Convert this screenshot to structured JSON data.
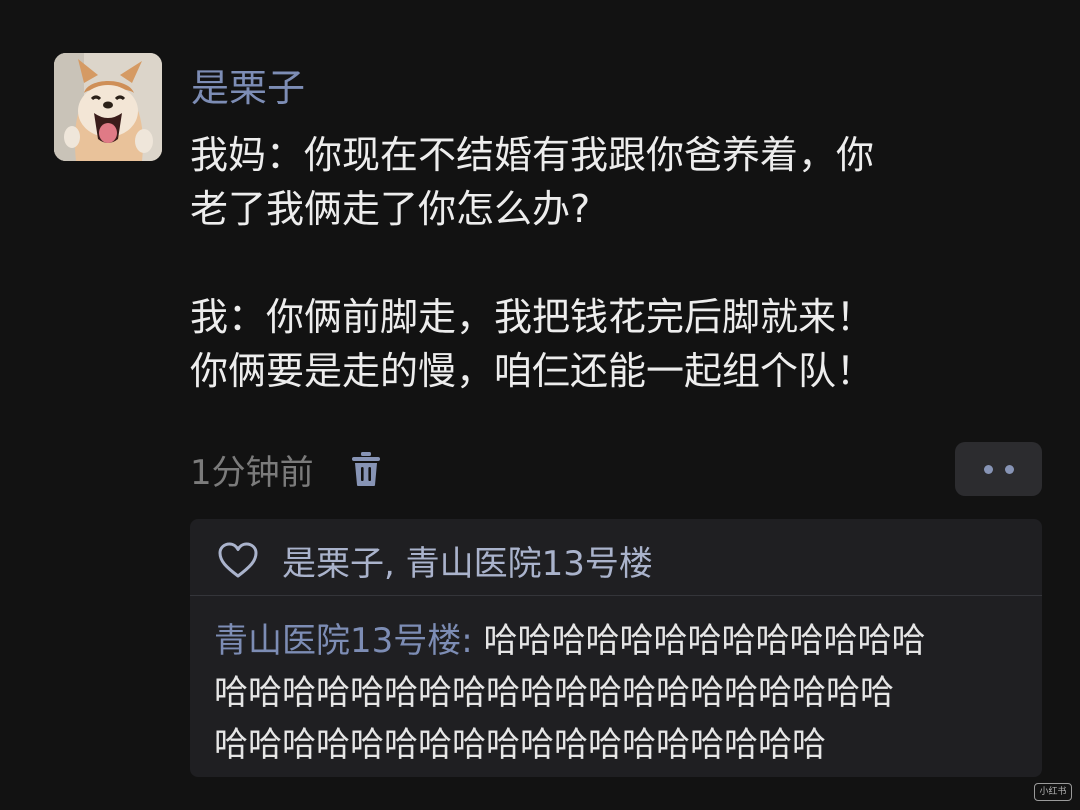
{
  "post": {
    "author": "是栗子",
    "content_lines": [
      "我妈：你现在不结婚有我跟你爸养着，你",
      "老了我俩走了你怎么办?",
      "我：你俩前脚走，我把钱花完后脚就来！",
      "你俩要是走的慢，咱仨还能一起组个队！"
    ],
    "timestamp": "1分钟前",
    "delete_icon": "trash-icon",
    "more_icon": "more-dots-icon"
  },
  "likes": {
    "icon": "heart-icon",
    "names": "是栗子, 青山医院13号楼"
  },
  "reply": {
    "author": "青山医院13号楼",
    "separator": ":",
    "text_lines": [
      "哈哈哈哈哈哈哈哈哈哈哈哈哈",
      "哈哈哈哈哈哈哈哈哈哈哈哈哈哈哈哈哈哈哈哈",
      "哈哈哈哈哈哈哈哈哈哈哈哈哈哈哈哈哈哈"
    ]
  },
  "watermark": "小红书",
  "colors": {
    "background": "#121212",
    "name_blue": "#7d8db5",
    "card": "#1f1f22"
  }
}
